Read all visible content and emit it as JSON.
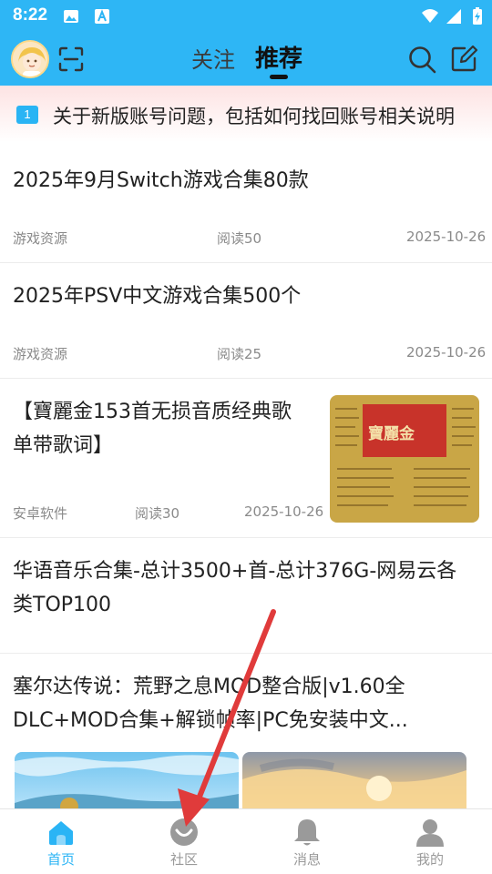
{
  "status_bar": {
    "time": "8:22"
  },
  "header": {
    "tabs": [
      {
        "label": "关注",
        "active": false
      },
      {
        "label": "推荐",
        "active": true
      }
    ],
    "icons": [
      "avatar",
      "scan-icon",
      "search-icon",
      "edit-icon"
    ]
  },
  "notice": {
    "badge": "1",
    "text": "关于新版账号问题，包括如何找回账号相关说明"
  },
  "feed": [
    {
      "title": "2025年9月Switch游戏合集80款",
      "category": "游戏资源",
      "reads": "阅读50",
      "date": "2025-10-26"
    },
    {
      "title": "2025年PSV中文游戏合集500个",
      "category": "游戏资源",
      "reads": "阅读25",
      "date": "2025-10-26"
    },
    {
      "title_line1": "【寶麗金153首无损音质经典歌",
      "title_line2": "单带歌词】",
      "category": "安卓软件",
      "reads": "阅读30",
      "date": "2025-10-26",
      "thumb_text": "寶麗金"
    },
    {
      "title_line1": "华语音乐合集-总计3500+首-总计376G-网易云各",
      "title_line2": "类TOP100"
    },
    {
      "title_line1": "塞尔达传说：荒野之息MOD整合版|v1.60全",
      "title_line2": "DLC+MOD合集+解锁帧率|PC免安装中文..."
    }
  ],
  "bottom_nav": [
    {
      "label": "首页",
      "active": true
    },
    {
      "label": "社区",
      "active": false
    },
    {
      "label": "消息",
      "active": false
    },
    {
      "label": "我的",
      "active": false
    }
  ],
  "colors": {
    "accent": "#2eb6f5",
    "active_nav": "#2ab4f5",
    "annotation_arrow": "#e03b3b"
  }
}
